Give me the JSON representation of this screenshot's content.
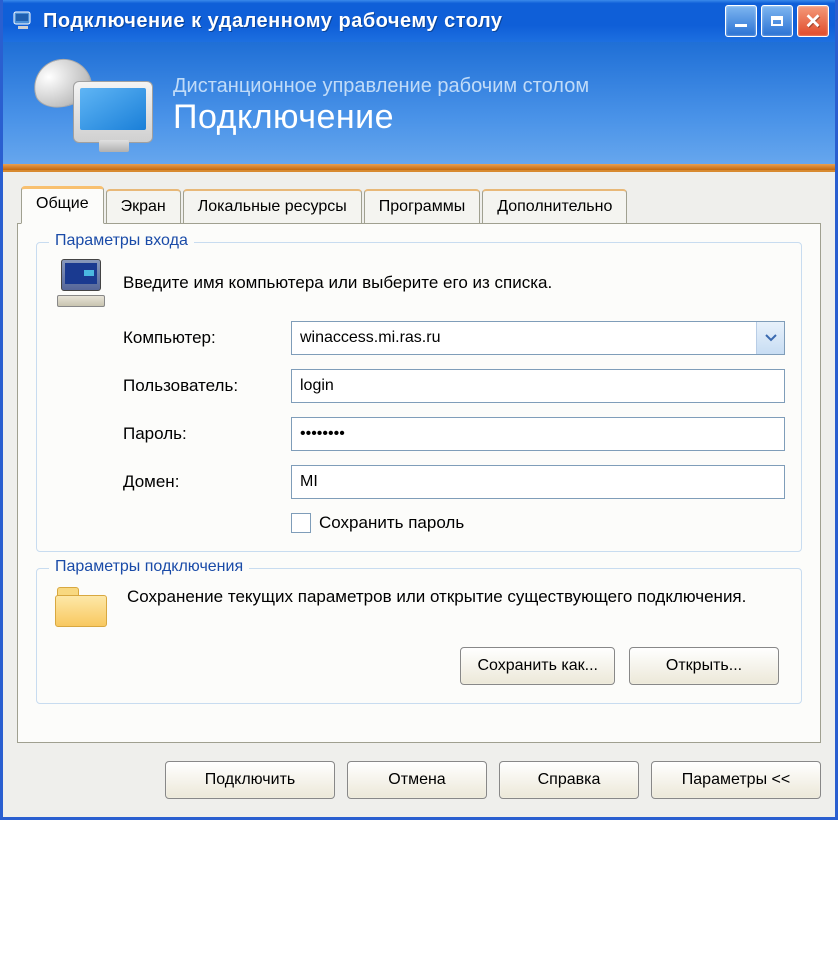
{
  "window": {
    "title": "Подключение к удаленному рабочему столу"
  },
  "banner": {
    "subtitle": "Дистанционное управление рабочим столом",
    "title": "Подключение"
  },
  "tabs": {
    "general": "Общие",
    "screen": "Экран",
    "local": "Локальные ресурсы",
    "programs": "Программы",
    "advanced": "Дополнительно"
  },
  "login_group": {
    "legend": "Параметры входа",
    "instruction": "Введите имя компьютера или выберите его из списка.",
    "computer_label": "Компьютер:",
    "computer_value": "winaccess.mi.ras.ru",
    "user_label": "Пользователь:",
    "user_value": "login",
    "password_label": "Пароль:",
    "password_value": "••••••••",
    "domain_label": "Домен:",
    "domain_value": "MI",
    "save_password_label": "Сохранить пароль"
  },
  "conn_group": {
    "legend": "Параметры подключения",
    "instruction": "Сохранение текущих параметров или открытие существующего подключения.",
    "save_as_label": "Сохранить как...",
    "open_label": "Открыть..."
  },
  "footer": {
    "connect": "Подключить",
    "cancel": "Отмена",
    "help": "Справка",
    "params": "Параметры <<"
  }
}
